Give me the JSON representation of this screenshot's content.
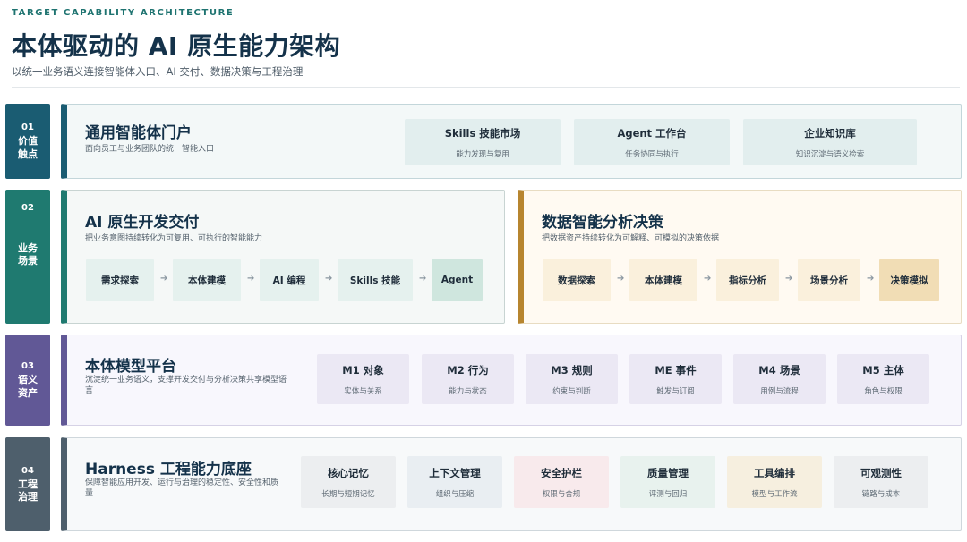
{
  "header": {
    "eyebrow": "TARGET CAPABILITY ARCHITECTURE",
    "title": "本体驱动的 AI 原生能力架构",
    "subtitle": "以统一业务语义连接智能体入口、AI 交付、数据决策与工程治理"
  },
  "layers": [
    {
      "num": "01",
      "label": "价值触点",
      "color": "#1a5c72"
    },
    {
      "num": "02",
      "label": "业务场景",
      "color": "#1f7a70"
    },
    {
      "num": "03",
      "label": "语义资产",
      "color": "#615896"
    },
    {
      "num": "04",
      "label": "工程治理",
      "color": "#4e5f6c"
    }
  ],
  "portal": {
    "title": "通用智能体门户",
    "desc": "面向员工与业务团队的统一智能入口",
    "items": [
      {
        "title": "Skills 技能市场",
        "sub": "能力发现与复用"
      },
      {
        "title": "Agent 工作台",
        "sub": "任务协同与执行"
      },
      {
        "title": "企业知识库",
        "sub": "知识沉淀与语义检索"
      }
    ]
  },
  "dev": {
    "title": "AI 原生开发交付",
    "desc": "把业务意图持续转化为可复用、可执行的智能能力",
    "steps": [
      "需求探索",
      "本体建模",
      "AI 编程",
      "Skills 技能",
      "Agent"
    ]
  },
  "data": {
    "title": "数据智能分析决策",
    "desc": "把数据资产持续转化为可解释、可模拟的决策依据",
    "steps": [
      "数据探索",
      "本体建模",
      "指标分析",
      "场景分析",
      "决策模拟"
    ]
  },
  "ontology": {
    "title": "本体模型平台",
    "desc": "沉淀统一业务语义，支撑开发交付与分析决策共享模型语言",
    "items": [
      {
        "title": "M1 对象",
        "sub": "实体与关系"
      },
      {
        "title": "M2 行为",
        "sub": "能力与状态"
      },
      {
        "title": "M3 规则",
        "sub": "约束与判断"
      },
      {
        "title": "ME 事件",
        "sub": "触发与订阅"
      },
      {
        "title": "M4 场景",
        "sub": "用例与流程"
      },
      {
        "title": "M5 主体",
        "sub": "角色与权限"
      }
    ]
  },
  "harness": {
    "title": "Harness 工程能力底座",
    "desc": "保障智能应用开发、运行与治理的稳定性、安全性和质量",
    "items": [
      {
        "title": "核心记忆",
        "sub": "长期与短期记忆",
        "color": "#eceef0"
      },
      {
        "title": "上下文管理",
        "sub": "组织与压缩",
        "color": "#e9eef2"
      },
      {
        "title": "安全护栏",
        "sub": "权限与合规",
        "color": "#f8eaec"
      },
      {
        "title": "质量管理",
        "sub": "评测与回归",
        "color": "#e8f2ee"
      },
      {
        "title": "工具编排",
        "sub": "模型与工作流",
        "color": "#f6efdf"
      },
      {
        "title": "可观测性",
        "sub": "链路与成本",
        "color": "#eceef0"
      }
    ]
  }
}
